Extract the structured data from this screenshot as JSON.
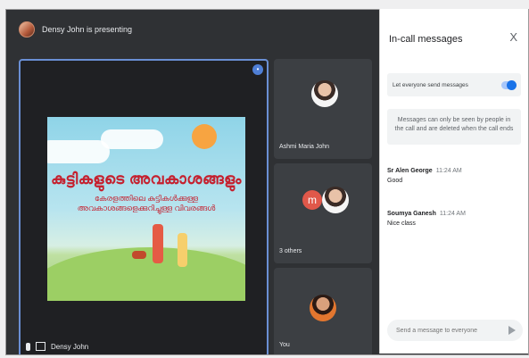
{
  "topbar": {
    "presenting_text": "Densy John is presenting"
  },
  "main_tile": {
    "name": "Densy John",
    "slide_title": "കുട്ടികളുടെ അവകാശങ്ങളും",
    "slide_subtitle": "കേരളത്തിലെ കുട്ടികൾക്കുള്ള അവകാശങ്ങളെക്കുറിച്ചുള്ള വിവരങ്ങൾ"
  },
  "participants": [
    {
      "name": "Ashmi Maria John",
      "initial": ""
    },
    {
      "name": "3 others",
      "initial": "m"
    },
    {
      "name": "You",
      "initial": ""
    }
  ],
  "panel": {
    "title": "In-call messages",
    "close_label": "X",
    "toggle_label": "Let everyone send messages",
    "toggle_on": true,
    "note": "Messages can only be seen by people in the call and are deleted when the call ends",
    "messages": [
      {
        "sender": "Sr Alen George",
        "time": "11:24 AM",
        "text": "Good"
      },
      {
        "sender": "Soumya Ganesh",
        "time": "11:24 AM",
        "text": "Nice class"
      }
    ],
    "compose_placeholder": "Send a message to everyone"
  },
  "colors": {
    "accent": "#1a73e8",
    "dark_bg": "#2f3134",
    "tile_border": "#6a8fd4"
  }
}
